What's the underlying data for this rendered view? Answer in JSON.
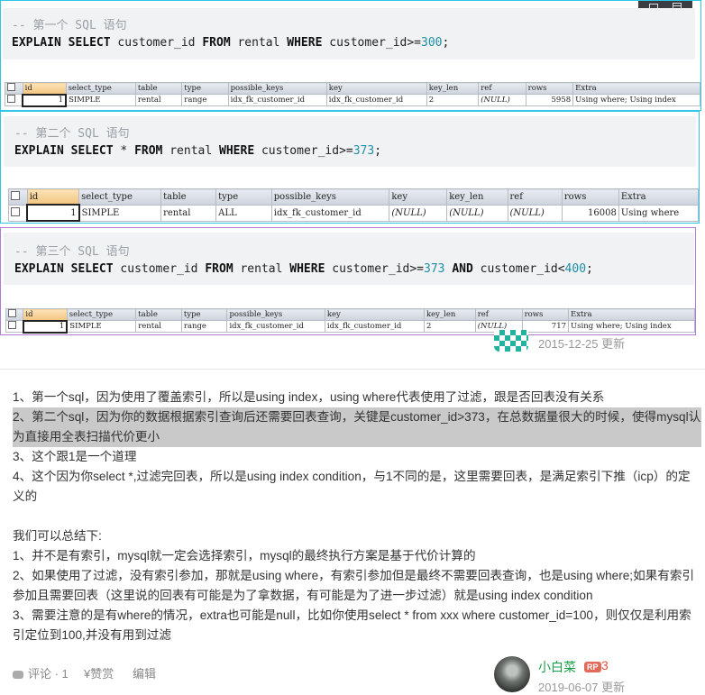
{
  "toolbar": {
    "icons": [
      "grid-view-icon",
      "list-view-icon"
    ]
  },
  "blocks": [
    {
      "comment": "-- 第一个 SQL 语句",
      "sql": [
        [
          "kw",
          "EXPLAIN"
        ],
        [
          "t",
          " "
        ],
        [
          "kw",
          "SELECT"
        ],
        [
          "t",
          " customer_id "
        ],
        [
          "kw",
          "FROM"
        ],
        [
          "t",
          " rental "
        ],
        [
          "kw",
          "WHERE"
        ],
        [
          "t",
          " customer_id>="
        ],
        [
          "num",
          "300"
        ],
        [
          "t",
          ";"
        ]
      ],
      "headers": [
        "id",
        "select_type",
        "table",
        "type",
        "possible_keys",
        "key",
        "key_len",
        "ref",
        "rows",
        "Extra"
      ],
      "row": [
        "1",
        "SIMPLE",
        "rental",
        "range",
        "idx_fk_customer_id",
        "idx_fk_customer_id",
        "2",
        "(NULL)",
        "5958",
        "Using where; Using index"
      ]
    },
    {
      "comment": "-- 第二个 SQL 语句",
      "sql": [
        [
          "kw",
          "EXPLAIN"
        ],
        [
          "t",
          " "
        ],
        [
          "kw",
          "SELECT"
        ],
        [
          "t",
          " * "
        ],
        [
          "kw",
          "FROM"
        ],
        [
          "t",
          " rental "
        ],
        [
          "kw",
          "WHERE"
        ],
        [
          "t",
          " customer_id>="
        ],
        [
          "num",
          "373"
        ],
        [
          "t",
          ";"
        ]
      ],
      "headers": [
        "id",
        "select_type",
        "table",
        "type",
        "possible_keys",
        "key",
        "key_len",
        "ref",
        "rows",
        "Extra"
      ],
      "row": [
        "1",
        "SIMPLE",
        "rental",
        "ALL",
        "idx_fk_customer_id",
        "(NULL)",
        "(NULL)",
        "(NULL)",
        "16008",
        "Using where"
      ]
    },
    {
      "comment": "-- 第三个 SQL 语句",
      "sql": [
        [
          "kw",
          "EXPLAIN"
        ],
        [
          "t",
          " "
        ],
        [
          "kw",
          "SELECT"
        ],
        [
          "t",
          " customer_id "
        ],
        [
          "kw",
          "FROM"
        ],
        [
          "t",
          " rental "
        ],
        [
          "kw",
          "WHERE"
        ],
        [
          "t",
          " customer_id>="
        ],
        [
          "num",
          "373"
        ],
        [
          "t",
          " "
        ],
        [
          "kw",
          "AND"
        ],
        [
          "t",
          " customer_id<"
        ],
        [
          "num",
          "400"
        ],
        [
          "t",
          ";"
        ]
      ],
      "headers": [
        "id",
        "select_type",
        "table",
        "type",
        "possible_keys",
        "key",
        "key_len",
        "ref",
        "rows",
        "Extra"
      ],
      "row": [
        "1",
        "SIMPLE",
        "rental",
        "range",
        "idx_fk_customer_id",
        "idx_fk_customer_id",
        "2",
        "(NULL)",
        "717",
        "Using where; Using index"
      ]
    }
  ],
  "answer1": {
    "date": "2015-12-25 更新"
  },
  "answer2": {
    "paragraphs": [
      "1、第一个sql，因为使用了覆盖索引，所以是using index，using where代表使用了过滤，跟是否回表没有关系",
      "2、第二个sql，因为你的数据根据索引查询后还需要回表查询，关键是customer_id>373，在总数据量很大的时候，使得mysql认为直接用全表扫描代价更小",
      "3、这个跟1是一个道理",
      "4、这个因为你select *,过滤完回表，所以是using index condition，与1不同的是，这里需要回表，是满足索引下推（icp）的定义的",
      "",
      "我们可以总结下:",
      "1、并不是有索引，mysql就一定会选择索引，mysql的最终执行方案是基于代价计算的",
      "2、如果使用了过滤，没有索引参加，那就是using where，有索引参加但是最终不需要回表查询，也是using where;如果有索引参加且需要回表（这里说的回表有可能是为了拿数据，有可能是为了进一步过滤）就是using index condition",
      "3、需要注意的是有where的情况，extra也可能是null，比如你使用select * from xxx where customer_id=100，则仅仅是利用索引定位到100,并没有用到过滤"
    ],
    "actions": {
      "comment": "评论 · 1",
      "reward": "¥赞赏",
      "edit": "编辑"
    },
    "author": {
      "name": "小白菜",
      "badge": "RP",
      "rep": "3",
      "date": "2019-06-07 更新"
    }
  }
}
